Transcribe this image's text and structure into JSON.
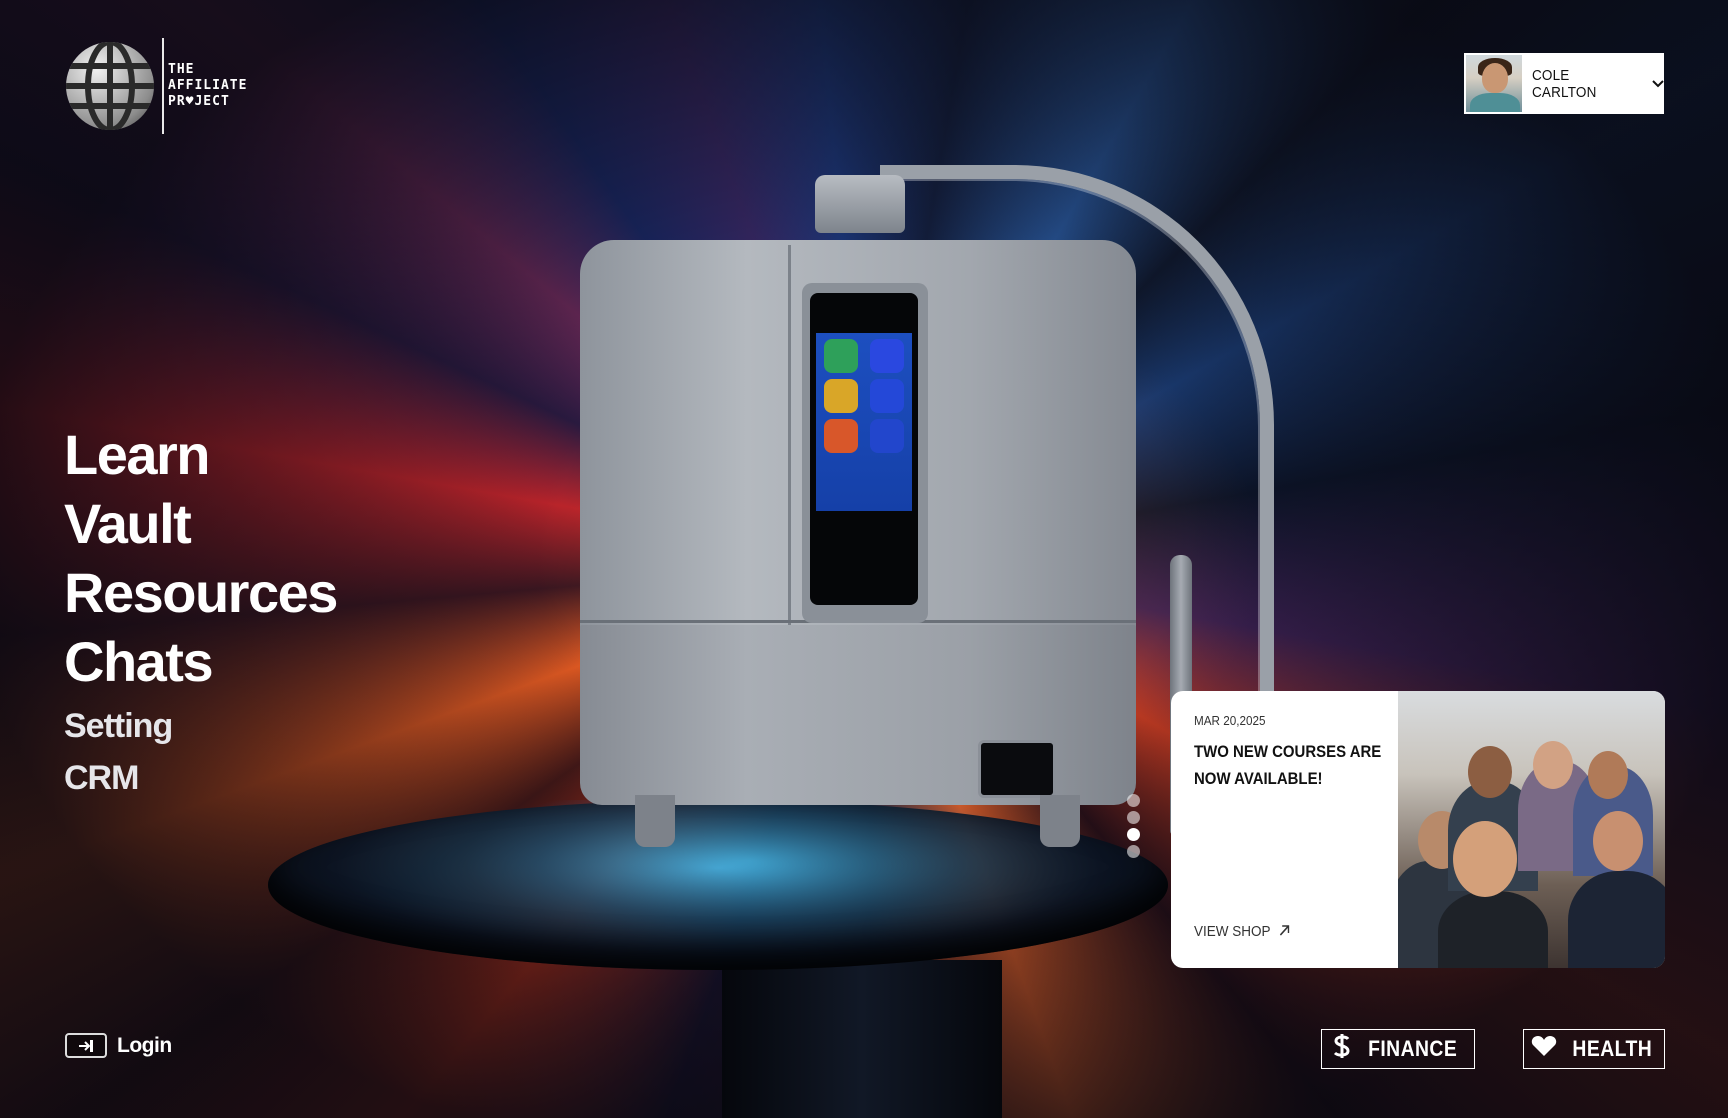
{
  "brand": {
    "logo_line1": "THE",
    "logo_line2": "AFFILIATE",
    "logo_line3": "PR♥JECT",
    "icon": "globe-logo-icon"
  },
  "user": {
    "name": "COLE CARLTON",
    "menu_icon": "chevron-down-icon"
  },
  "nav": {
    "primary": [
      "Learn",
      "Vault",
      "Resources",
      "Chats"
    ],
    "secondary": [
      "Setting",
      "CRM"
    ]
  },
  "carousel": {
    "slide_count": 4,
    "active_index": 2
  },
  "news_card": {
    "date": "MAR 20,2025",
    "title": "TWO NEW COURSES ARE NOW AVAILABLE!",
    "link_label": "VIEW SHOP",
    "link_icon": "arrow-up-right-icon"
  },
  "footer": {
    "login_label": "Login",
    "login_icon": "login-arrow-icon",
    "tags": [
      {
        "label": "FINANCE",
        "icon": "dollar-icon"
      },
      {
        "label": "HEALTH",
        "icon": "heart-icon"
      }
    ]
  },
  "colors": {
    "card_bg": "#ffffff",
    "text_primary": "#ffffff",
    "accent_warm": "#e25a22",
    "accent_cool": "#2a5aa0"
  }
}
